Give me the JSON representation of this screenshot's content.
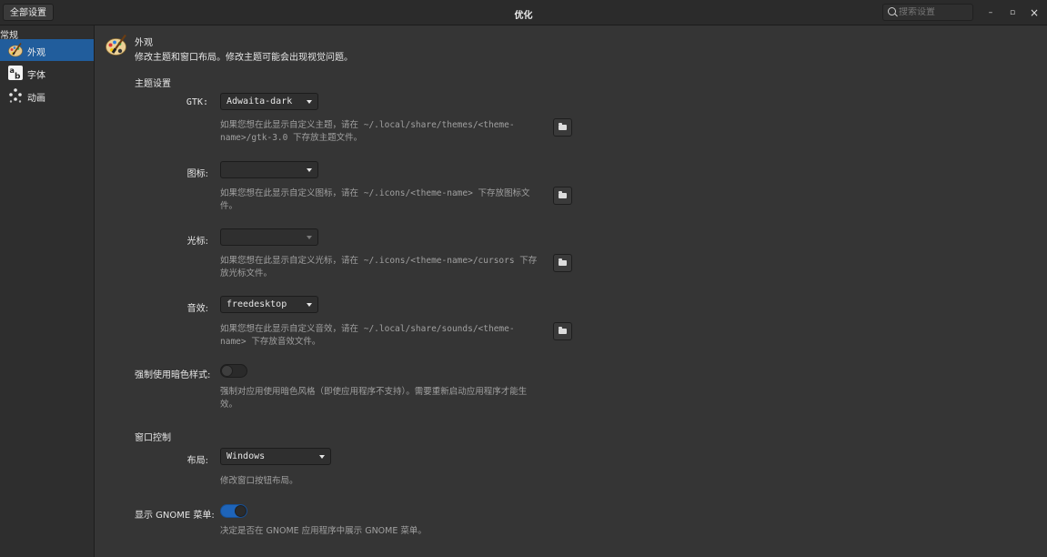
{
  "header": {
    "all_settings": "全部设置",
    "title": "优化",
    "search_placeholder": "搜索设置",
    "minimize": "–",
    "maximize": "▫",
    "close": "×"
  },
  "sidebar": {
    "heading": "常规",
    "items": [
      {
        "label": "外观",
        "icon": "appearance-palette-icon",
        "active": true
      },
      {
        "label": "字体",
        "icon": "font-ab-icon",
        "active": false
      },
      {
        "label": "动画",
        "icon": "animation-sparkle-icon",
        "active": false
      }
    ]
  },
  "page": {
    "title": "外观",
    "subtitle": "修改主题和窗口布局。修改主题可能会出现视觉问题。"
  },
  "theme_section": {
    "heading": "主题设置",
    "gtk": {
      "label": "GTK:",
      "value": "Adwaita-dark",
      "hint_line1": "如果您想在此显示自定义主题，请在 ~/.local/share/themes/<theme-",
      "hint_line2": "name>/gtk-3.0 下存放主题文件。"
    },
    "icons": {
      "label": "图标:",
      "value": "",
      "hint_line1": "如果您想在此显示自定义图标，请在 ~/.icons/<theme-name> 下存放图标文",
      "hint_line2": "件。"
    },
    "cursor": {
      "label": "光标:",
      "value": "",
      "hint_line1": "如果您想在此显示自定义光标，请在 ~/.icons/<theme-name>/cursors 下存",
      "hint_line2": "放光标文件。"
    },
    "sound": {
      "label": "音效:",
      "value": "freedesktop",
      "hint_line1": "如果您想在此显示自定义音效，请在 ~/.local/share/sounds/<theme-",
      "hint_line2": "name> 下存放音效文件。"
    },
    "dark_style": {
      "label": "强制使用暗色样式:",
      "enabled": false,
      "hint_line1": "强制对应用使用暗色风格（即使应用程序不支持）。需要重新启动应用程序才能生",
      "hint_line2": "效。"
    }
  },
  "window_section": {
    "heading": "窗口控制",
    "layout": {
      "label": "布局:",
      "value": "Windows",
      "hint": "修改窗口按钮布局。"
    },
    "gnome_menu": {
      "label": "显示 GNOME 菜单:",
      "enabled": true,
      "hint": "决定是否在 GNOME 应用程序中展示 GNOME 菜单。"
    }
  },
  "colors": {
    "accent": "#215d9c",
    "switch_on": "#1e64b9",
    "background": "#353535"
  }
}
